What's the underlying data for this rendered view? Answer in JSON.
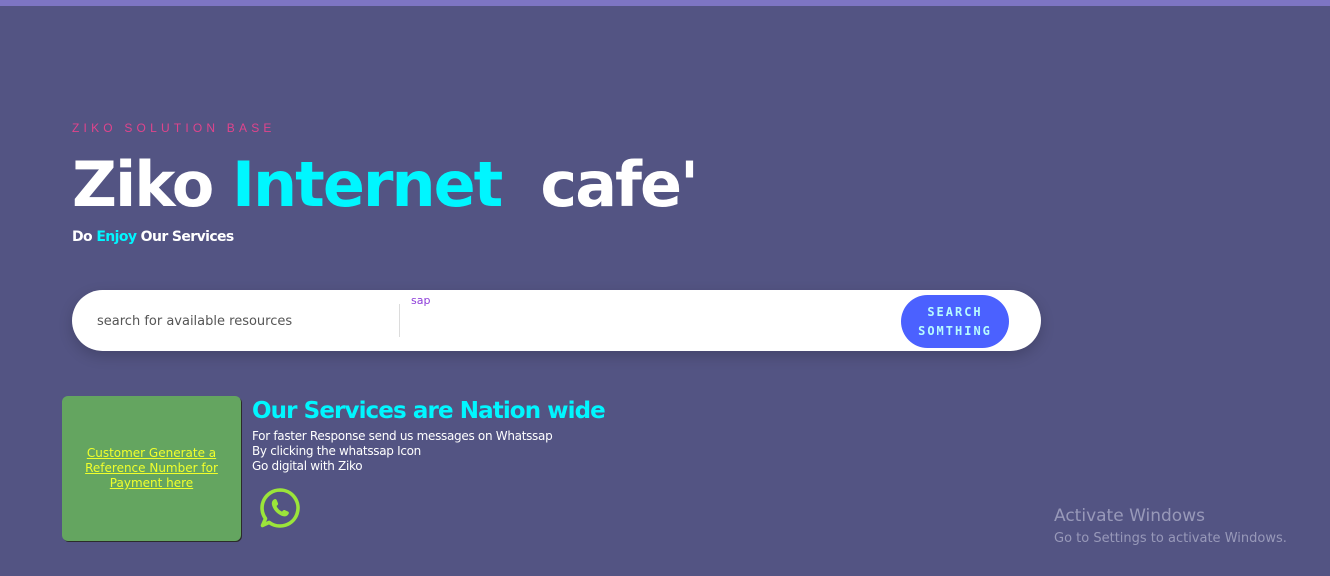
{
  "hero": {
    "eyebrow": "ZIKO SOLUTION BASE",
    "title_part1": "Ziko ",
    "title_accent": "Internet",
    "title_part2": "  cafe'",
    "tagline_part1": "Do ",
    "tagline_accent": "Enjoy",
    "tagline_part2": " Our Services"
  },
  "search": {
    "placeholder": "search for available resources",
    "hint": "sap",
    "button_label": "SEARCH SOMTHING"
  },
  "payment_card": {
    "link_text": "Customer Generate a Reference Number for Payment here"
  },
  "services": {
    "heading": "Our Services are Nation wide",
    "lines": [
      "For faster Response send us messages on Whatssap",
      "By clicking the whatssap Icon",
      "Go digital with Ziko"
    ],
    "icon": "whatsapp-icon"
  },
  "watermark": {
    "title": "Activate Windows",
    "subtitle": "Go to Settings to activate Windows."
  },
  "colors": {
    "background": "#535483",
    "accent_cyan": "#00f6ff",
    "eyebrow_pink": "#e0448c",
    "button_blue": "#4b61ff",
    "card_green": "#64a560",
    "link_yellow": "#f0ff2c",
    "whatsapp_green": "#9be53a"
  }
}
